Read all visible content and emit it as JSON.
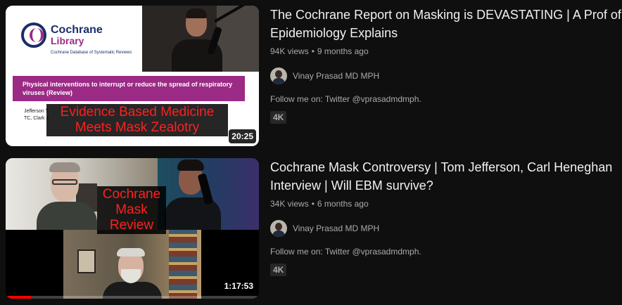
{
  "videos": [
    {
      "title": "The Cochrane Report on Masking is DEVASTATING | A Prof of Epidemiology Explains",
      "views": "94K views",
      "age": "9 months ago",
      "channel": "Vinay Prasad MD MPH",
      "description": "Follow me on: Twitter @vprasadmdmph.",
      "badge": "4K",
      "duration": "20:25",
      "thumbnail": {
        "logo_line1": "Cochrane",
        "logo_line2": "Library",
        "logo_subtitle": "Cochrane Database of Systematic Reviews",
        "banner": "Physical interventions to interrupt or reduce the spread of respiratory viruses (Review)",
        "authors": "Jefferson T\nTC, Clark J",
        "overlay": "Evidence Based Medicine Meets Mask Zealotry"
      }
    },
    {
      "title": "Cochrane Mask Controversy | Tom Jefferson, Carl Heneghan Interview | Will EBM survive?",
      "views": "34K views",
      "age": "6 months ago",
      "channel": "Vinay Prasad MD MPH",
      "description": "Follow me on: Twitter @vprasadmdmph.",
      "badge": "4K",
      "duration": "1:17:53",
      "watch_progress": 0.1,
      "thumbnail": {
        "overlay": "Cochrane Mask Review"
      }
    }
  ],
  "colors": {
    "background": "#0f0f0f",
    "title_text": "#f1f1f1",
    "secondary_text": "#aaaaaa",
    "progress_red": "#ff0000",
    "cochrane_purple": "#9b2b85",
    "cochrane_navy": "#1a2d6b",
    "overlay_red": "#ff2020"
  }
}
